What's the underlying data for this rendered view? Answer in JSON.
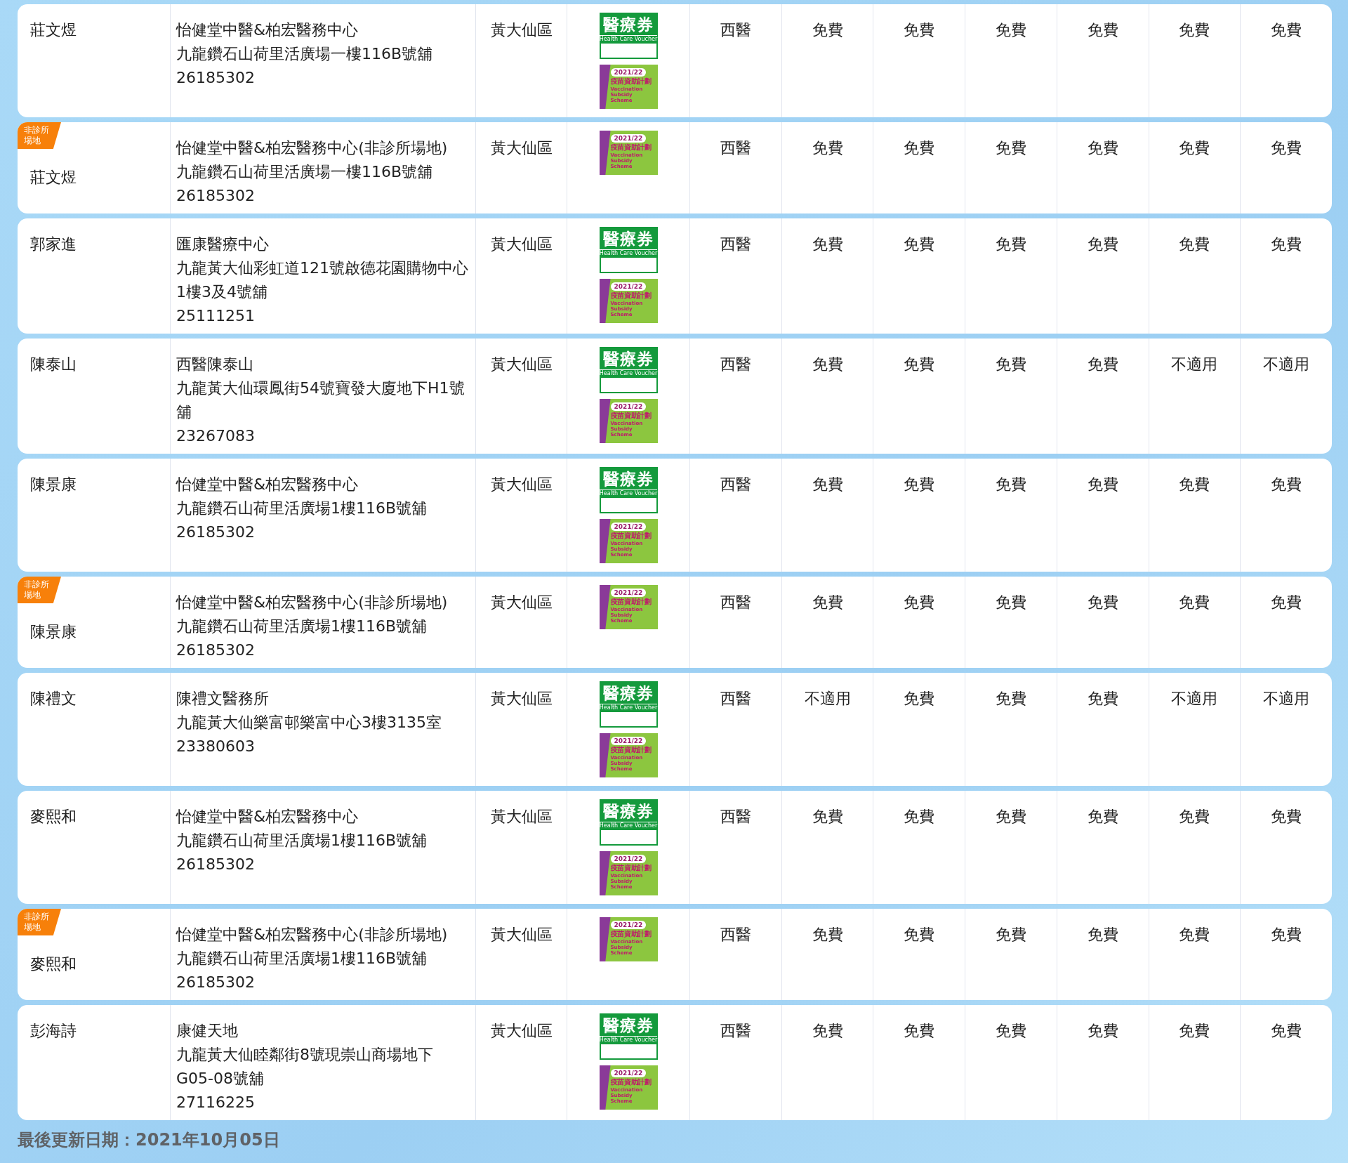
{
  "rows": [
    {
      "doctor": "莊文煜",
      "clinic": "怡健堂中醫&柏宏醫務中心",
      "address": "九龍鑽石山荷里活廣場一樓116B號舖",
      "phone": "26185302",
      "district": "黃大仙區",
      "logos": [
        {
          "kind": "voucher",
          "title": "醫療券",
          "subtitle": "Health Care Voucher"
        },
        {
          "kind": "vaccine",
          "year": "2021/22",
          "title": "疫苗資助計劃",
          "subtitle": "Vaccination Subsidy Scheme"
        }
      ],
      "specialty": "西醫",
      "fees": [
        "免費",
        "免費",
        "免費",
        "免費",
        "免費",
        "免費"
      ]
    },
    {
      "badge": "非診所場地",
      "doctor": "莊文煜",
      "clinic": "怡健堂中醫&柏宏醫務中心(非診所場地)",
      "address": "九龍鑽石山荷里活廣場一樓116B號舖",
      "phone": "26185302",
      "district": "黃大仙區",
      "logos": [
        {
          "kind": "vaccine",
          "year": "2021/22",
          "title": "疫苗資助計劃",
          "subtitle": "Vaccination Subsidy Scheme"
        }
      ],
      "specialty": "西醫",
      "fees": [
        "免費",
        "免費",
        "免費",
        "免費",
        "免費",
        "免費"
      ]
    },
    {
      "doctor": "郭家進",
      "clinic": "匯康醫療中心",
      "address": "九龍黃大仙彩虹道121號啟德花園購物中心1樓3及4號舖",
      "phone": "25111251",
      "district": "黃大仙區",
      "logos": [
        {
          "kind": "voucher",
          "title": "醫療券",
          "subtitle": "Health Care Voucher"
        },
        {
          "kind": "vaccine",
          "year": "2021/22",
          "title": "疫苗資助計劃",
          "subtitle": "Vaccination Subsidy Scheme"
        }
      ],
      "specialty": "西醫",
      "fees": [
        "免費",
        "免費",
        "免費",
        "免費",
        "免費",
        "免費"
      ]
    },
    {
      "doctor": "陳泰山",
      "clinic": "西醫陳泰山",
      "address": "九龍黃大仙環鳳街54號寶發大廈地下H1號舖",
      "phone": "23267083",
      "district": "黃大仙區",
      "logos": [
        {
          "kind": "voucher",
          "title": "醫療券",
          "subtitle": "Health Care Voucher"
        },
        {
          "kind": "vaccine",
          "year": "2021/22",
          "title": "疫苗資助計劃",
          "subtitle": "Vaccination Subsidy Scheme"
        }
      ],
      "specialty": "西醫",
      "fees": [
        "免費",
        "免費",
        "免費",
        "免費",
        "不適用",
        "不適用"
      ]
    },
    {
      "doctor": "陳景康",
      "clinic": "怡健堂中醫&柏宏醫務中心",
      "address": "九龍鑽石山荷里活廣場1樓116B號舖",
      "phone": "26185302",
      "district": "黃大仙區",
      "logos": [
        {
          "kind": "voucher",
          "title": "醫療券",
          "subtitle": "Health Care Voucher"
        },
        {
          "kind": "vaccine",
          "year": "2021/22",
          "title": "疫苗資助計劃",
          "subtitle": "Vaccination Subsidy Scheme"
        }
      ],
      "specialty": "西醫",
      "fees": [
        "免費",
        "免費",
        "免費",
        "免費",
        "免費",
        "免費"
      ]
    },
    {
      "badge": "非診所場地",
      "doctor": "陳景康",
      "clinic": "怡健堂中醫&柏宏醫務中心(非診所場地)",
      "address": "九龍鑽石山荷里活廣場1樓116B號舖",
      "phone": "26185302",
      "district": "黃大仙區",
      "logos": [
        {
          "kind": "vaccine",
          "year": "2021/22",
          "title": "疫苗資助計劃",
          "subtitle": "Vaccination Subsidy Scheme"
        }
      ],
      "specialty": "西醫",
      "fees": [
        "免費",
        "免費",
        "免費",
        "免費",
        "免費",
        "免費"
      ]
    },
    {
      "doctor": "陳禮文",
      "clinic": "陳禮文醫務所",
      "address": "九龍黃大仙樂富邨樂富中心3樓3135室",
      "phone": "23380603",
      "district": "黃大仙區",
      "logos": [
        {
          "kind": "voucher",
          "title": "醫療券",
          "subtitle": "Health Care Voucher"
        },
        {
          "kind": "vaccine",
          "year": "2021/22",
          "title": "疫苗資助計劃",
          "subtitle": "Vaccination Subsidy Scheme"
        }
      ],
      "specialty": "西醫",
      "fees": [
        "不適用",
        "免費",
        "免費",
        "免費",
        "不適用",
        "不適用"
      ]
    },
    {
      "doctor": "麥熙和",
      "clinic": "怡健堂中醫&柏宏醫務中心",
      "address": "九龍鑽石山荷里活廣場1樓116B號舖",
      "phone": "26185302",
      "district": "黃大仙區",
      "logos": [
        {
          "kind": "voucher",
          "title": "醫療券",
          "subtitle": "Health Care Voucher"
        },
        {
          "kind": "vaccine",
          "year": "2021/22",
          "title": "疫苗資助計劃",
          "subtitle": "Vaccination Subsidy Scheme"
        }
      ],
      "specialty": "西醫",
      "fees": [
        "免費",
        "免費",
        "免費",
        "免費",
        "免費",
        "免費"
      ]
    },
    {
      "badge": "非診所場地",
      "doctor": "麥熙和",
      "clinic": "怡健堂中醫&柏宏醫務中心(非診所場地)",
      "address": "九龍鑽石山荷里活廣場1樓116B號舖",
      "phone": "26185302",
      "district": "黃大仙區",
      "logos": [
        {
          "kind": "vaccine",
          "year": "2021/22",
          "title": "疫苗資助計劃",
          "subtitle": "Vaccination Subsidy Scheme"
        }
      ],
      "specialty": "西醫",
      "fees": [
        "免費",
        "免費",
        "免費",
        "免費",
        "免費",
        "免費"
      ]
    },
    {
      "doctor": "彭海詩",
      "clinic": "康健天地",
      "address": "九龍黃大仙睦鄰街8號現崇山商場地下G05-08號舖",
      "phone": "27116225",
      "district": "黃大仙區",
      "logos": [
        {
          "kind": "voucher",
          "title": "醫療券",
          "subtitle": "Health Care Voucher"
        },
        {
          "kind": "vaccine",
          "year": "2021/22",
          "title": "疫苗資助計劃",
          "subtitle": "Vaccination Subsidy Scheme"
        }
      ],
      "specialty": "西醫",
      "fees": [
        "免費",
        "免費",
        "免費",
        "免費",
        "免費",
        "免費"
      ]
    }
  ],
  "last_updated": "最後更新日期：2021年10月05日"
}
